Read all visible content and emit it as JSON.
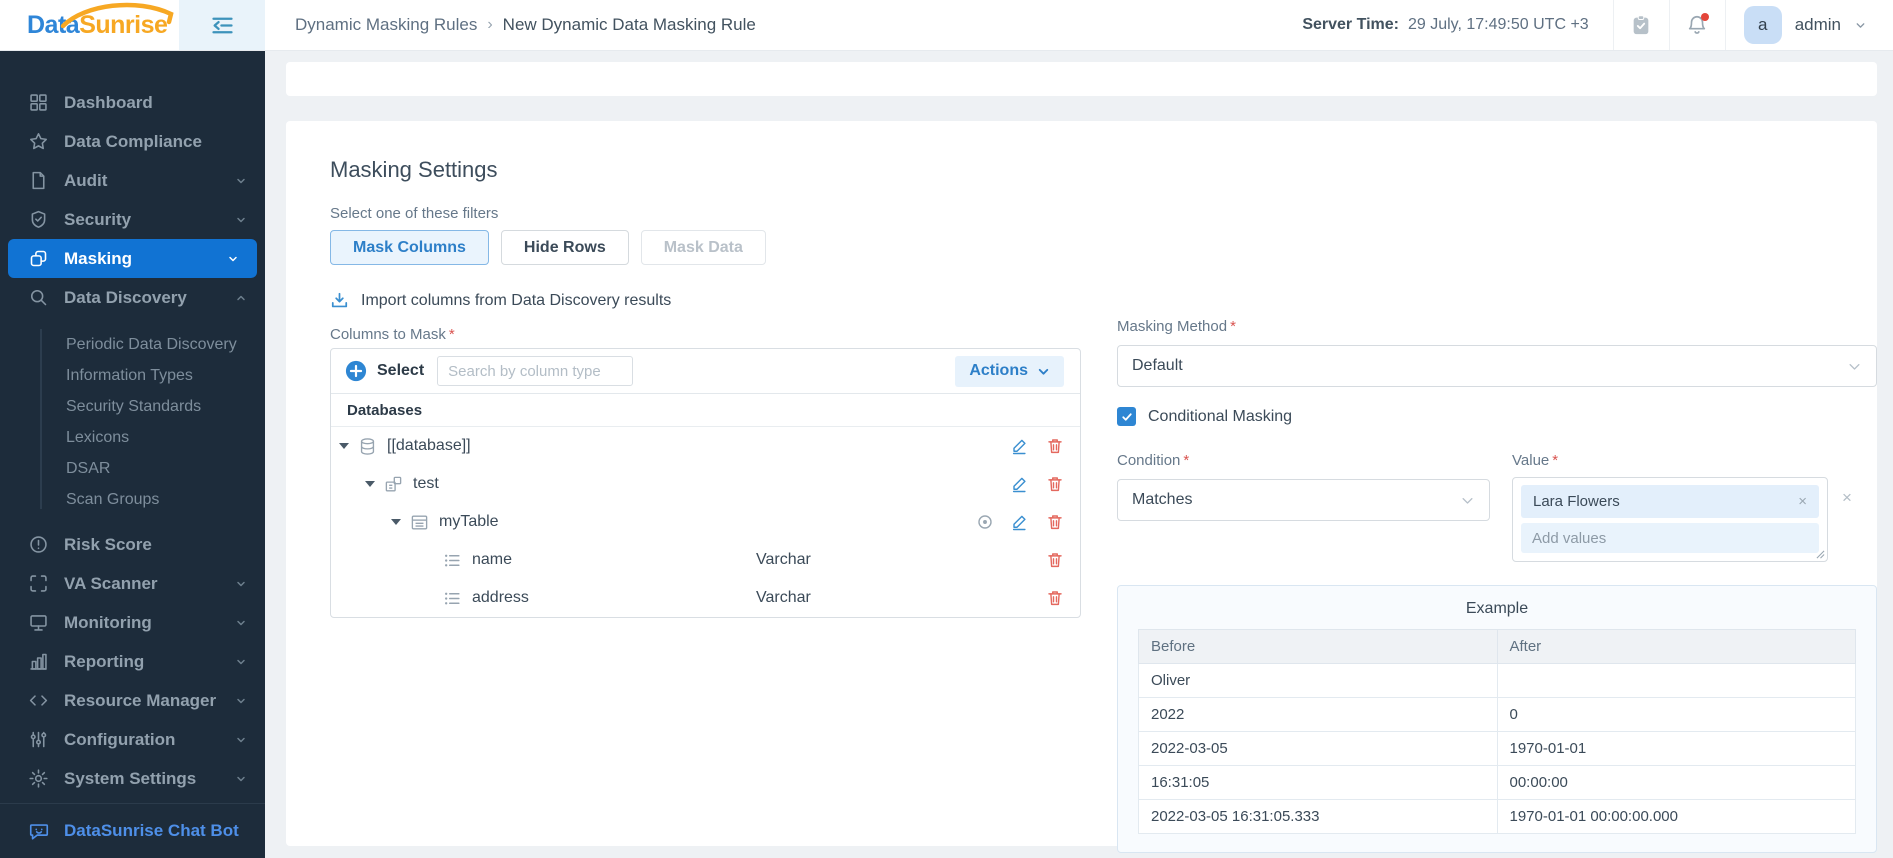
{
  "brand": {
    "part1": "Data",
    "part2": "Sunrise"
  },
  "topbar": {
    "breadcrumb_root": "Dynamic Masking Rules",
    "breadcrumb_sep": "›",
    "breadcrumb_current": "New Dynamic Data Masking Rule",
    "server_time_label": "Server Time:",
    "server_time_value": "29 July, 17:49:50 UTC +3",
    "avatar_letter": "a",
    "user_name": "admin"
  },
  "sidebar": {
    "items": [
      {
        "label": "Dashboard"
      },
      {
        "label": "Data Compliance"
      },
      {
        "label": "Audit"
      },
      {
        "label": "Security"
      },
      {
        "label": "Masking"
      },
      {
        "label": "Data Discovery"
      },
      {
        "label": "Risk Score"
      },
      {
        "label": "VA Scanner"
      },
      {
        "label": "Monitoring"
      },
      {
        "label": "Reporting"
      },
      {
        "label": "Resource Manager"
      },
      {
        "label": "Configuration"
      },
      {
        "label": "System Settings"
      }
    ],
    "discovery_sub": [
      {
        "label": "Periodic Data Discovery"
      },
      {
        "label": "Information Types"
      },
      {
        "label": "Security Standards"
      },
      {
        "label": "Lexicons"
      },
      {
        "label": "DSAR"
      },
      {
        "label": "Scan Groups"
      }
    ],
    "chat_bot": "DataSunrise Chat Bot"
  },
  "main": {
    "title": "Masking Settings",
    "filters_label": "Select one of these filters",
    "required_mark": "*",
    "filters": [
      {
        "label": "Mask Columns",
        "state": "active"
      },
      {
        "label": "Hide Rows",
        "state": "default"
      },
      {
        "label": "Mask Data",
        "state": "disabled"
      }
    ],
    "import_label": "Import columns from Data Discovery results",
    "columns_label": "Columns to Mask",
    "tree": {
      "select_label": "Select",
      "search_placeholder": "Search by column type",
      "actions_label": "Actions",
      "group_header": "Databases",
      "database": "[[database]]",
      "schema": "test",
      "table": "myTable",
      "columns": [
        {
          "name": "name",
          "datatype": "Varchar"
        },
        {
          "name": "address",
          "datatype": "Varchar"
        }
      ]
    },
    "method": {
      "label": "Masking Method",
      "value": "Default"
    },
    "conditional_label": "Conditional Masking",
    "condition": {
      "label": "Condition",
      "value": "Matches"
    },
    "value": {
      "label": "Value",
      "chip": "Lara Flowers",
      "placeholder": "Add values",
      "chip_remove": "×",
      "clear_all": "×"
    },
    "example": {
      "title": "Example",
      "headers": [
        "Before",
        "After"
      ],
      "rows": [
        [
          "Oliver",
          ""
        ],
        [
          "2022",
          "0"
        ],
        [
          "2022-03-05",
          "1970-01-01"
        ],
        [
          "16:31:05",
          "00:00:00"
        ],
        [
          "2022-03-05 16:31:05.333",
          "1970-01-01 00:00:00.000"
        ]
      ]
    }
  },
  "colors": {
    "accent": "#2e86d3",
    "sidebar_active": "#1173d3",
    "danger": "#e4685e",
    "brand_blue": "#2f86d8",
    "brand_orange": "#f7a823"
  }
}
